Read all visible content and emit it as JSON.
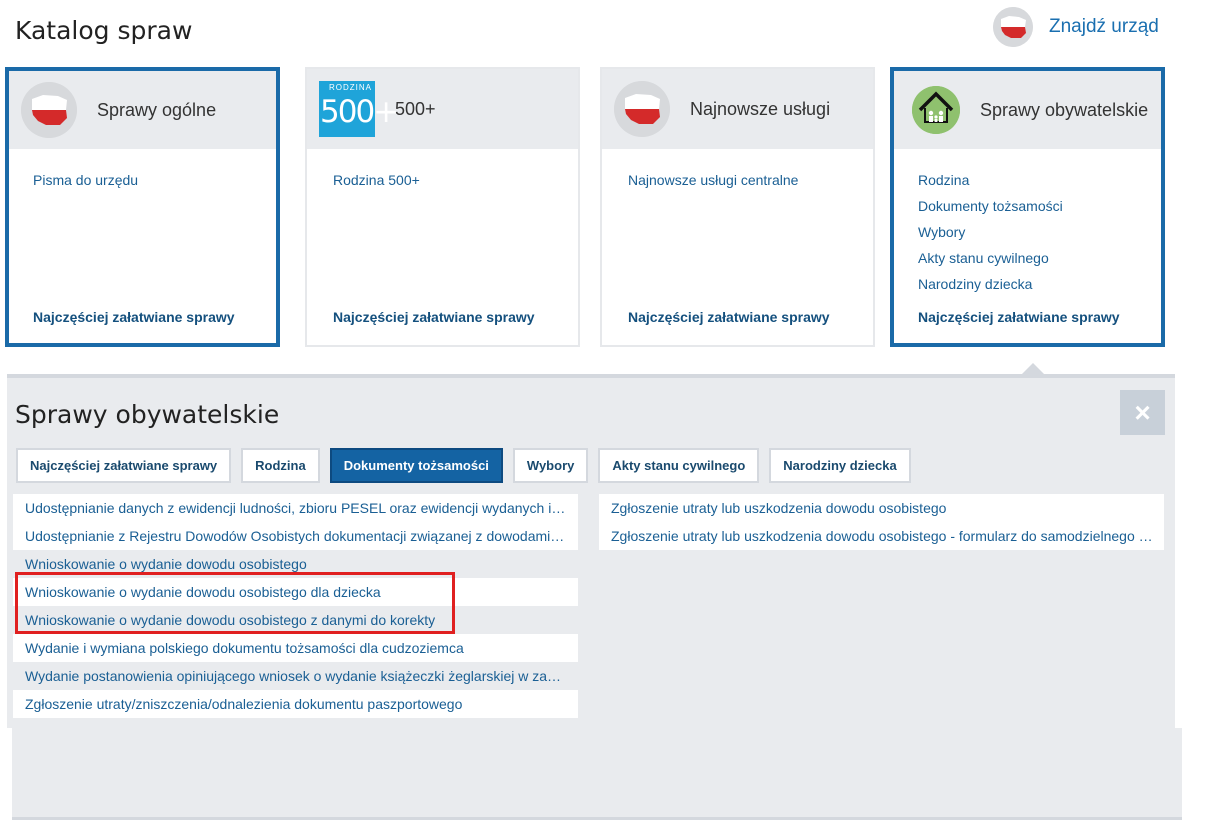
{
  "header": {
    "title": "Katalog spraw",
    "find_office": "Znajdź urząd"
  },
  "cards": [
    {
      "title": "Sprawy ogólne",
      "links": [
        "Pisma do urzędu"
      ],
      "footer": "Najczęściej załatwiane sprawy"
    },
    {
      "title": "500+",
      "logo_small": "RODZINA",
      "logo_big": "500+",
      "links": [
        "Rodzina 500+"
      ],
      "footer": "Najczęściej załatwiane sprawy"
    },
    {
      "title": "Najnowsze usługi",
      "links": [
        "Najnowsze usługi centralne"
      ],
      "footer": "Najczęściej załatwiane sprawy"
    },
    {
      "title": "Sprawy obywatelskie",
      "links": [
        "Rodzina",
        "Dokumenty tożsamości",
        "Wybory",
        "Akty stanu cywilnego",
        "Narodziny dziecka"
      ],
      "footer": "Najczęściej załatwiane sprawy"
    }
  ],
  "panel": {
    "title": "Sprawy obywatelskie",
    "close_icon": "×",
    "tabs": [
      {
        "label": "Najczęściej załatwiane sprawy"
      },
      {
        "label": "Rodzina"
      },
      {
        "label": "Dokumenty tożsamości"
      },
      {
        "label": "Wybory"
      },
      {
        "label": "Akty stanu cywilnego"
      },
      {
        "label": "Narodziny dziecka"
      }
    ],
    "active_tab": "Dokumenty tożsamości",
    "left_items": [
      "Udostępnianie danych z ewidencji ludności, zbioru PESEL oraz ewidencji wydanych i…",
      "Udostępnianie z Rejestru Dowodów Osobistych dokumentacji związanej z dowodami…",
      "Wnioskowanie o wydanie dowodu osobistego",
      "Wnioskowanie o wydanie dowodu osobistego dla dziecka",
      "Wnioskowanie o wydanie dowodu osobistego z danymi do korekty",
      "Wydanie i wymiana polskiego dokumentu tożsamości dla cudzoziemca",
      "Wydanie postanowienia opiniującego wniosek o wydanie książeczki żeglarskiej w za…",
      "Zgłoszenie utraty/zniszczenia/odnalezienia dokumentu paszportowego"
    ],
    "right_items": [
      "Zgłoszenie utraty lub uszkodzenia dowodu osobistego",
      "Zgłoszenie utraty lub uszkodzenia dowodu osobistego - formularz do samodzielnego …"
    ]
  },
  "colors": {
    "accent_blue": "#1a6aa8",
    "link_blue": "#1a5f94",
    "highlight_red": "#e02020",
    "panel_bg": "#e9ebee"
  }
}
